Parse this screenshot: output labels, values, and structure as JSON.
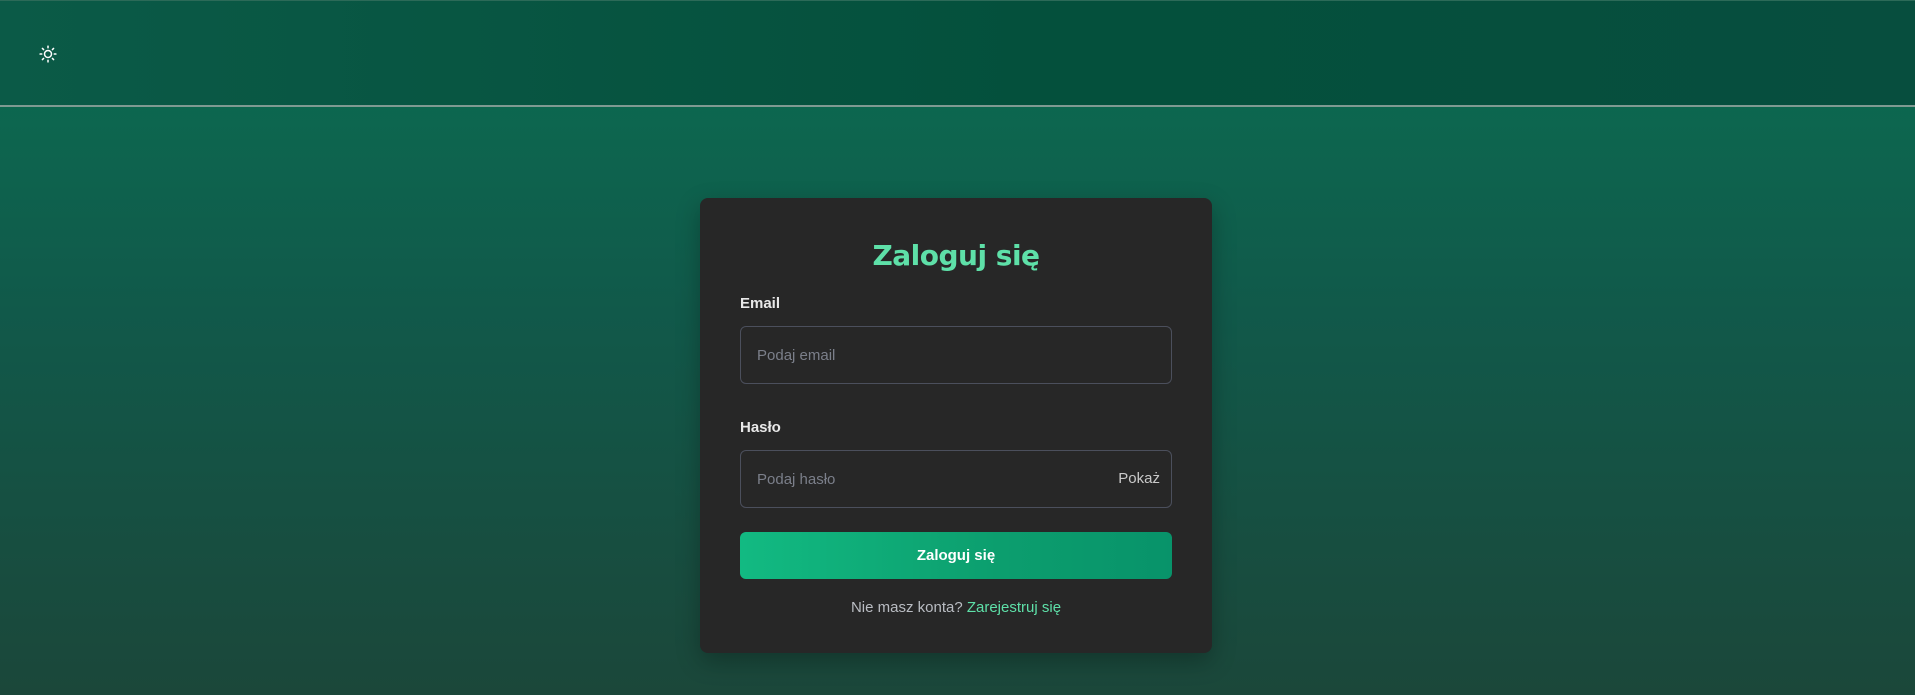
{
  "header": {
    "theme_toggle_icon": "sun-icon"
  },
  "login": {
    "title": "Zaloguj się",
    "email_label": "Email",
    "email_placeholder": "Podaj email",
    "email_value": "",
    "password_label": "Hasło",
    "password_placeholder": "Podaj hasło",
    "password_value": "",
    "show_password_label": "Pokaż",
    "submit_label": "Zaloguj się",
    "no_account_text": "Nie masz konta?",
    "signup_link_label": "Zarejestruj się"
  },
  "colors": {
    "accent": "#5ee0a8",
    "button": "#10b07c",
    "card_background": "#272727",
    "header_background": "#04503c"
  }
}
